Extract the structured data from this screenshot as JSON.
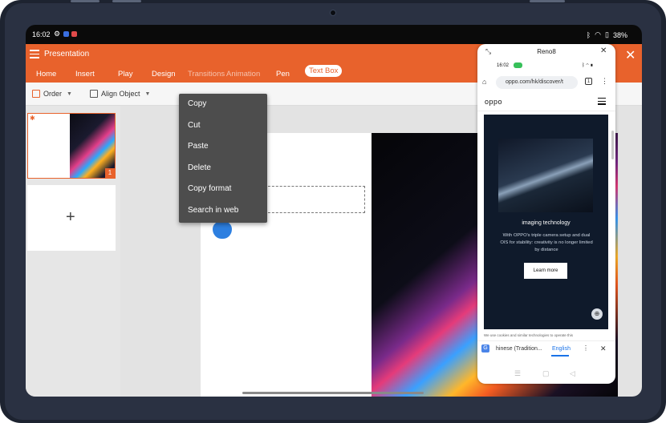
{
  "status_bar": {
    "time": "16:02",
    "battery": "38%",
    "signal_icons": [
      "bluetooth-icon",
      "wifi-icon",
      "silent-icon"
    ]
  },
  "app": {
    "title": "Presentation",
    "tabs": [
      {
        "label": "Home"
      },
      {
        "label": "Insert"
      },
      {
        "label": "Play"
      },
      {
        "label": "Design"
      },
      {
        "label": "Transitions"
      },
      {
        "label": "Animation"
      },
      {
        "label": "Pen"
      },
      {
        "label": "Text Box",
        "active": true
      }
    ],
    "toolbar": {
      "order_label": "Order",
      "align_label": "Align Object"
    },
    "slides": [
      {
        "number": "1"
      }
    ],
    "accent_color": "#e8622c"
  },
  "context_menu": {
    "items": [
      "Copy",
      "Cut",
      "Paste",
      "Delete",
      "Copy format",
      "Search in web"
    ]
  },
  "floating_window": {
    "title": "Reno8",
    "status_time": "16:02",
    "url": "oppo.com/hk/discover/t",
    "tab_count": "1",
    "site_logo": "oppo",
    "caption": "imaging technology",
    "description": "With OPPO's triple camera setup and dual OIS for stability: creativity is no longer limited by distance",
    "button_label": "Learn more",
    "hint_text": "We use cookies and similar technologies to operate this",
    "translate": {
      "from": "hinese (Tradition...",
      "to": "English"
    }
  }
}
